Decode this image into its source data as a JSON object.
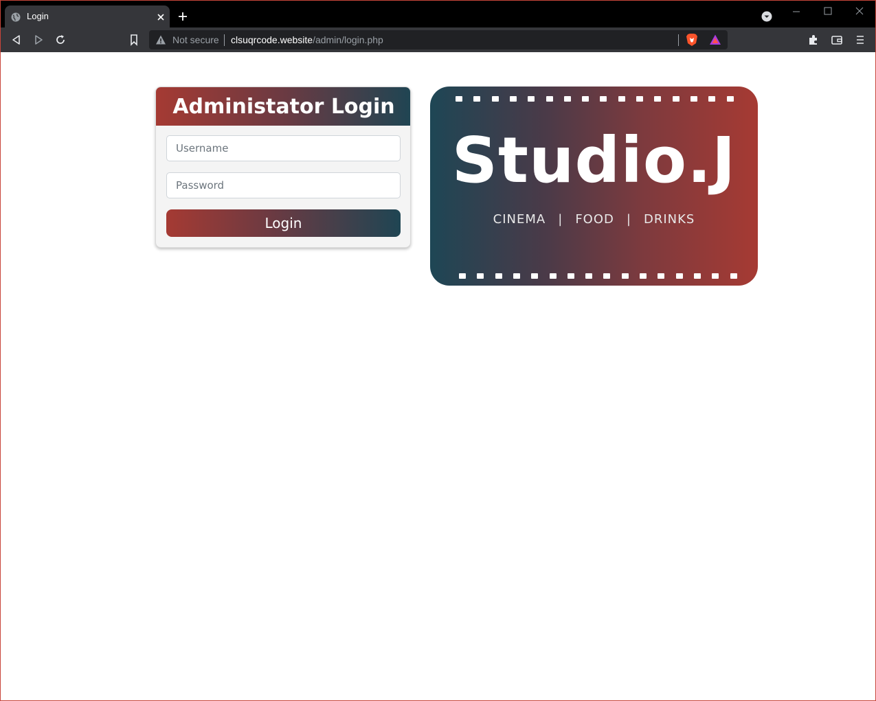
{
  "browser": {
    "tab": {
      "title": "Login",
      "favicon_icon": "globe-icon",
      "close_icon": "close-icon"
    },
    "new_tab_icon": "plus-icon",
    "tab_search_icon": "chevron-down-icon",
    "address_bar": {
      "security_label": "Not secure",
      "url_host": "clsuqrcode.website",
      "url_path": "/admin/login.php"
    }
  },
  "login": {
    "title": "Administator Login",
    "username_placeholder": "Username",
    "password_placeholder": "Password",
    "button_label": "Login"
  },
  "banner": {
    "logo_text": "Studio.J",
    "tagline": [
      "CINEMA",
      "FOOD",
      "DRINKS"
    ],
    "separator": "|"
  },
  "colors": {
    "gradient_red": "#a53a33",
    "gradient_teal": "#1f4553",
    "browser_dark": "#35363a"
  }
}
